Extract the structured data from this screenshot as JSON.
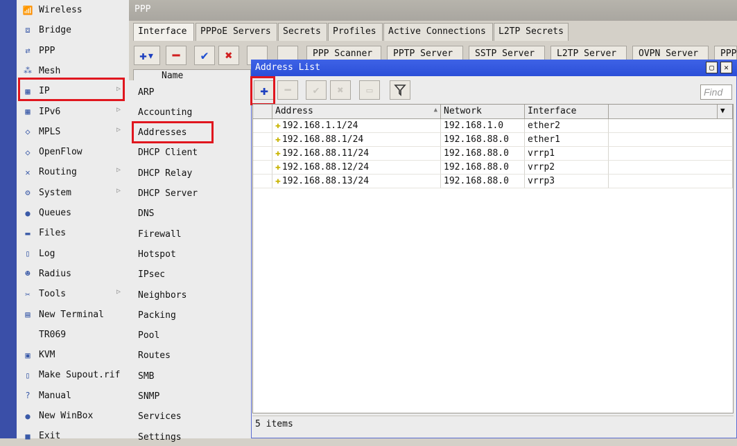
{
  "sidebar": {
    "items": [
      {
        "label": "Wireless",
        "icon": "wireless-icon",
        "glyph": "📶",
        "arrow": false
      },
      {
        "label": "Bridge",
        "icon": "bridge-icon",
        "glyph": "⧈",
        "arrow": false
      },
      {
        "label": "PPP",
        "icon": "ppp-icon",
        "glyph": "⇄",
        "arrow": false
      },
      {
        "label": "Mesh",
        "icon": "mesh-icon",
        "glyph": "⁂",
        "arrow": false
      },
      {
        "label": "IP",
        "icon": "ip-icon",
        "glyph": "▦",
        "arrow": true,
        "highlight": true
      },
      {
        "label": "IPv6",
        "icon": "ipv6-icon",
        "glyph": "▦",
        "arrow": true
      },
      {
        "label": "MPLS",
        "icon": "mpls-icon",
        "glyph": "◇",
        "arrow": true
      },
      {
        "label": "OpenFlow",
        "icon": "openflow-icon",
        "glyph": "◇",
        "arrow": false
      },
      {
        "label": "Routing",
        "icon": "routing-icon",
        "glyph": "✕",
        "arrow": true
      },
      {
        "label": "System",
        "icon": "system-icon",
        "glyph": "⚙",
        "arrow": true
      },
      {
        "label": "Queues",
        "icon": "queues-icon",
        "glyph": "●",
        "arrow": false
      },
      {
        "label": "Files",
        "icon": "files-icon",
        "glyph": "▬",
        "arrow": false
      },
      {
        "label": "Log",
        "icon": "log-icon",
        "glyph": "▯",
        "arrow": false
      },
      {
        "label": "Radius",
        "icon": "radius-icon",
        "glyph": "☻",
        "arrow": false
      },
      {
        "label": "Tools",
        "icon": "tools-icon",
        "glyph": "✂",
        "arrow": true
      },
      {
        "label": "New Terminal",
        "icon": "terminal-icon",
        "glyph": "▤",
        "arrow": false
      },
      {
        "label": "TR069",
        "icon": "",
        "glyph": "",
        "arrow": false
      },
      {
        "label": "KVM",
        "icon": "kvm-icon",
        "glyph": "▣",
        "arrow": false
      },
      {
        "label": "Make Supout.rif",
        "icon": "supout-icon",
        "glyph": "▯",
        "arrow": false
      },
      {
        "label": "Manual",
        "icon": "manual-icon",
        "glyph": "?",
        "arrow": false
      },
      {
        "label": "New WinBox",
        "icon": "winbox-icon",
        "glyph": "●",
        "arrow": false
      },
      {
        "label": "Exit",
        "icon": "exit-icon",
        "glyph": "■",
        "arrow": false
      }
    ]
  },
  "ppp_window": {
    "title": "PPP",
    "tabs": [
      "Interface",
      "PPPoE Servers",
      "Secrets",
      "Profiles",
      "Active Connections",
      "L2TP Secrets"
    ],
    "tool_buttons": [
      "PPP Scanner",
      "PPTP Server",
      "SSTP Server",
      "L2TP Server",
      "OVPN Server",
      "PPP"
    ],
    "name_col": "Name"
  },
  "ip_submenu": {
    "items": [
      "ARP",
      "Accounting",
      "Addresses",
      "DHCP Client",
      "DHCP Relay",
      "DHCP Server",
      "DNS",
      "Firewall",
      "Hotspot",
      "IPsec",
      "Neighbors",
      "Packing",
      "Pool",
      "Routes",
      "SMB",
      "SNMP",
      "Services",
      "Settings"
    ],
    "highlight_index": 2
  },
  "address_list": {
    "title": "Address List",
    "find_placeholder": "Find",
    "columns": [
      "Address",
      "Network",
      "Interface"
    ],
    "rows": [
      {
        "address": "192.168.1.1/24",
        "network": "192.168.1.0",
        "interface": "ether2"
      },
      {
        "address": "192.168.88.1/24",
        "network": "192.168.88.0",
        "interface": "ether1"
      },
      {
        "address": "192.168.88.11/24",
        "network": "192.168.88.0",
        "interface": "vrrp1"
      },
      {
        "address": "192.168.88.12/24",
        "network": "192.168.88.0",
        "interface": "vrrp2"
      },
      {
        "address": "192.168.88.13/24",
        "network": "192.168.88.0",
        "interface": "vrrp3"
      }
    ],
    "status": "5 items"
  },
  "colors": {
    "highlight": "#e0161e",
    "accent": "#2b4fd8",
    "add": "#1d3fbf",
    "remove": "#d12020",
    "ok": "#1f4fd1"
  }
}
